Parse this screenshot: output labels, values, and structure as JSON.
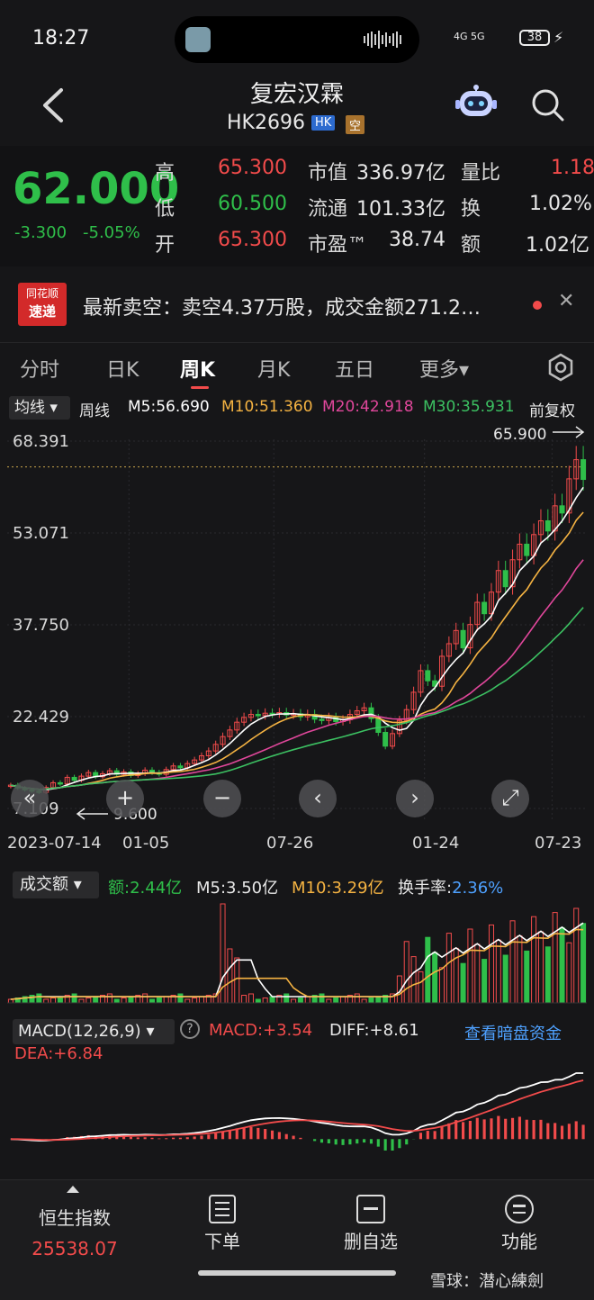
{
  "status": {
    "time": "18:27",
    "signal": "4G 5G",
    "battery": "38"
  },
  "header": {
    "title": "复宏汉霖",
    "code": "HK2696",
    "tag_market": "HK",
    "tag_short": "空"
  },
  "quote": {
    "price": "62.000",
    "change": "-3.300",
    "change_pct": "-5.05%",
    "high_label": "高",
    "high": "65.300",
    "low_label": "低",
    "low": "60.500",
    "open_label": "开",
    "open": "65.300",
    "mcap_label": "市值",
    "mcap": "336.97亿",
    "float_label": "流通",
    "float": "101.33亿",
    "pe_label": "市盈™",
    "pe": "38.74",
    "volratio_label": "量比",
    "volratio": "1.18",
    "turnover_label": "换",
    "turnover": "1.02%",
    "amount_label": "额",
    "amount": "1.02亿"
  },
  "news": {
    "logo_top": "同花顺",
    "logo_bottom": "速递",
    "text": "最新卖空：卖空4.37万股，成交金额271.2…"
  },
  "tabs": [
    {
      "label": "分时"
    },
    {
      "label": "日K"
    },
    {
      "label": "周K"
    },
    {
      "label": "月K"
    },
    {
      "label": "五日"
    },
    {
      "label": "更多▾"
    }
  ],
  "ma_bar": {
    "dropdown": "均线",
    "period": "周线",
    "m5": "M5:56.690",
    "m10": "M10:51.360",
    "m20": "M20:42.918",
    "m30": "M30:35.931",
    "adjust": "前复权",
    "colors": {
      "m5": "#ffffff",
      "m10": "#f5b342",
      "m20": "#e0479b",
      "m30": "#3cc162"
    }
  },
  "chart_data": [
    {
      "type": "candlestick",
      "title": "",
      "y_ticks": [
        "68.391",
        "53.071",
        "37.750",
        "22.429",
        "7.109"
      ],
      "ylim": [
        7.109,
        68.391
      ],
      "x_ticks": [
        "2023-07-14",
        "01-05",
        "07-26",
        "01-24",
        "07-23"
      ],
      "annotations": {
        "high": "65.900",
        "low": "9.600"
      },
      "weekly_close": [
        11,
        10.5,
        10.2,
        10,
        9.8,
        10.6,
        11.4,
        11.2,
        12.3,
        11.8,
        12.5,
        13.1,
        12.4,
        12.9,
        13.4,
        12.8,
        13.2,
        12.6,
        12.9,
        13.5,
        13.1,
        12.8,
        13.6,
        14.2,
        13.9,
        14.6,
        15.2,
        15.9,
        16.7,
        17.8,
        19.1,
        20.2,
        21.5,
        22.3,
        22.8,
        22.6,
        23.0,
        22.9,
        23.1,
        22.7,
        22.9,
        22.4,
        22.8,
        22.0,
        21.8,
        22.3,
        21.6,
        21.9,
        22.8,
        23.4,
        23.9,
        22.1,
        19.8,
        17.5,
        19.6,
        21.8,
        23.6,
        26.5,
        30.1,
        28.4,
        27.5,
        32.5,
        34.6,
        36.8,
        33.9,
        37.8,
        41.5,
        39.6,
        43.2,
        46.8,
        44.1,
        48.6,
        51.2,
        49.3,
        52.8,
        55.1,
        53.4,
        57.6,
        56.4,
        62.1,
        65.3,
        62.0
      ]
    },
    {
      "type": "bar",
      "title": "",
      "label": "成交额",
      "values_text": {
        "amount": "额:2.44亿",
        "m5": "M5:3.50亿",
        "m10": "M10:3.29亿",
        "turnover": "换手率:2.36%"
      }
    },
    {
      "type": "bar",
      "title": "",
      "label": "MACD(12,26,9)",
      "values_text": {
        "macd": "MACD:+3.54",
        "diff": "DIFF:+8.61",
        "dea": "DEA:+6.84"
      }
    }
  ],
  "macd_link": "查看暗盘资金",
  "bottom": {
    "index_name": "恒生指数",
    "index_value": "25538.07",
    "order": "下单",
    "watch": "删自选",
    "func": "功能"
  },
  "watermark": "雪球：潜心練劍"
}
